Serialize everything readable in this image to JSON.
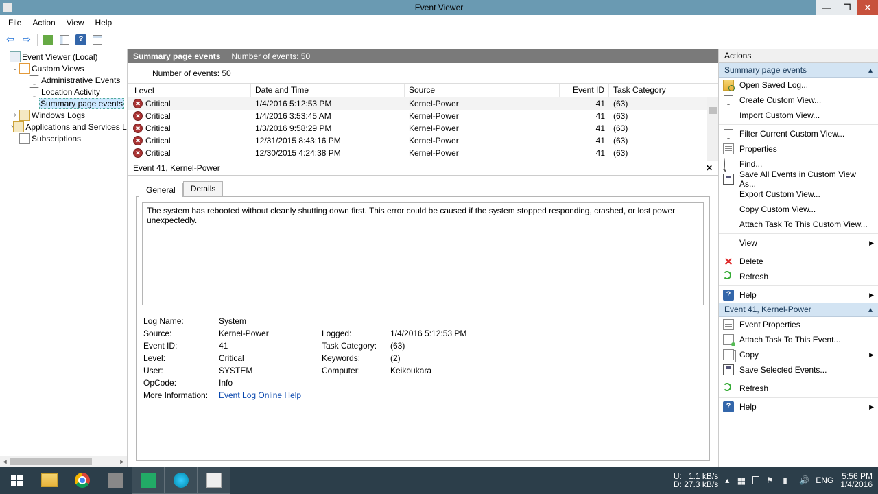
{
  "titlebar": {
    "title": "Event Viewer"
  },
  "menu": {
    "file": "File",
    "action": "Action",
    "view": "View",
    "help": "Help"
  },
  "tree": {
    "root": "Event Viewer (Local)",
    "custom_views": "Custom Views",
    "admin_events": "Administrative Events",
    "location_activity": "Location Activity",
    "summary_page": "Summary page events",
    "windows_logs": "Windows Logs",
    "app_services": "Applications and Services Lo",
    "subscriptions": "Subscriptions"
  },
  "section": {
    "title": "Summary page events",
    "count_label": "Number of events: 50"
  },
  "filter": {
    "count": "Number of events: 50"
  },
  "columns": {
    "level": "Level",
    "date": "Date and Time",
    "source": "Source",
    "eid": "Event ID",
    "task": "Task Category"
  },
  "rows": [
    {
      "level": "Critical",
      "date": "1/4/2016 5:12:53 PM",
      "source": "Kernel-Power",
      "eid": "41",
      "task": "(63)"
    },
    {
      "level": "Critical",
      "date": "1/4/2016 3:53:45 AM",
      "source": "Kernel-Power",
      "eid": "41",
      "task": "(63)"
    },
    {
      "level": "Critical",
      "date": "1/3/2016 9:58:29 PM",
      "source": "Kernel-Power",
      "eid": "41",
      "task": "(63)"
    },
    {
      "level": "Critical",
      "date": "12/31/2015 8:43:16 PM",
      "source": "Kernel-Power",
      "eid": "41",
      "task": "(63)"
    },
    {
      "level": "Critical",
      "date": "12/30/2015 4:24:38 PM",
      "source": "Kernel-Power",
      "eid": "41",
      "task": "(63)"
    }
  ],
  "detail": {
    "header": "Event 41, Kernel-Power",
    "tab_general": "General",
    "tab_details": "Details",
    "description": "The system has rebooted without cleanly shutting down first. This error could be caused if the system stopped responding, crashed, or lost power unexpectedly.",
    "labels": {
      "logname": "Log Name:",
      "source": "Source:",
      "eventid": "Event ID:",
      "level": "Level:",
      "user": "User:",
      "opcode": "OpCode:",
      "moreinfo": "More Information:",
      "logged": "Logged:",
      "taskcat": "Task Category:",
      "keywords": "Keywords:",
      "computer": "Computer:"
    },
    "values": {
      "logname": "System",
      "source": "Kernel-Power",
      "eventid": "41",
      "level": "Critical",
      "user": "SYSTEM",
      "opcode": "Info",
      "moreinfo": "Event Log Online Help",
      "logged": "1/4/2016 5:12:53 PM",
      "taskcat": "(63)",
      "keywords": "(2)",
      "computer": "Keikoukara"
    }
  },
  "actions": {
    "pane_title": "Actions",
    "section1": "Summary page events",
    "section2": "Event 41, Kernel-Power",
    "open_saved": "Open Saved Log...",
    "create_view": "Create Custom View...",
    "import_view": "Import Custom View...",
    "filter_view": "Filter Current Custom View...",
    "properties": "Properties",
    "find": "Find...",
    "save_all": "Save All Events in Custom View As...",
    "export_view": "Export Custom View...",
    "copy_view": "Copy Custom View...",
    "attach_task_view": "Attach Task To This Custom View...",
    "view": "View",
    "delete": "Delete",
    "refresh": "Refresh",
    "help": "Help",
    "event_props": "Event Properties",
    "attach_task_event": "Attach Task To This Event...",
    "copy": "Copy",
    "save_selected": "Save Selected Events...",
    "refresh2": "Refresh",
    "help2": "Help"
  },
  "taskbar": {
    "net": {
      "up_label": "U:",
      "up": "1.1 kB/s",
      "down_label": "D:",
      "down": "27.3 kB/s"
    },
    "lang": "ENG",
    "time": "5:56 PM",
    "date": "1/4/2016"
  }
}
